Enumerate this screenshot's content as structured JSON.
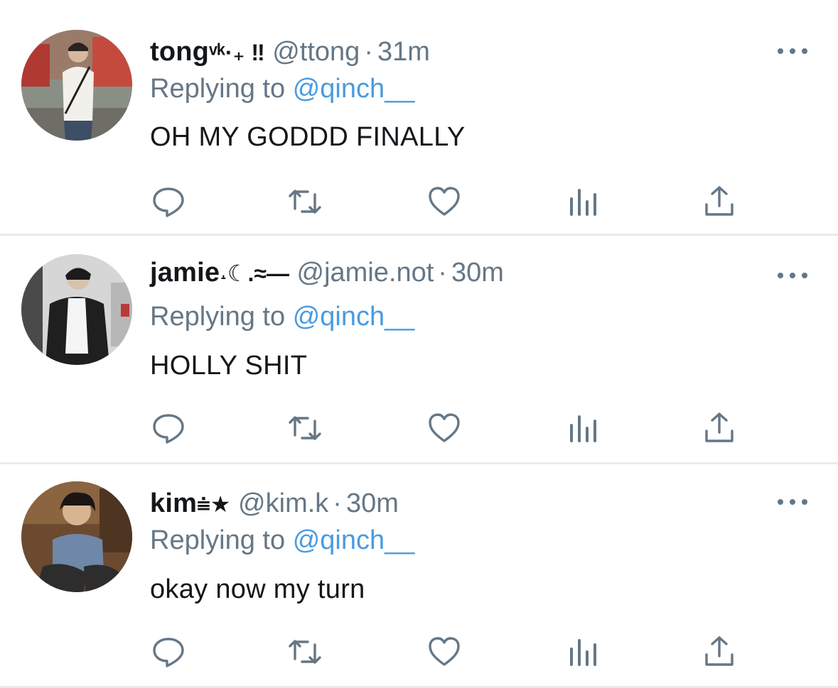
{
  "tweets": [
    {
      "display_name": "tong",
      "name_decoration": "ᵛᵏ·₊ ‼",
      "handle": "@ttong",
      "time": "31m",
      "replying_prefix": "Replying to",
      "replying_to": "@qinch__",
      "text": "OH MY GODDD FINALLY"
    },
    {
      "display_name": "jamie",
      "name_decoration": "˔☾.≈—",
      "handle": "@jamie.not",
      "time": "30m",
      "replying_prefix": "Replying to",
      "replying_to": "@qinch__",
      "text": "HOLLY SHIT"
    },
    {
      "display_name": "kim",
      "name_decoration": "⩧★",
      "handle": "@kim.k",
      "time": "30m",
      "replying_prefix": "Replying to",
      "replying_to": "@qinch__",
      "text": "okay now my turn"
    }
  ],
  "separator": "·",
  "icons": {
    "reply": "reply-icon",
    "retweet": "retweet-icon",
    "like": "heart-icon",
    "analytics": "analytics-icon",
    "share": "share-icon",
    "more": "more-dots-icon"
  },
  "colors": {
    "text": "#14171a",
    "secondary": "#657786",
    "link": "#4a9be0",
    "divider": "#e6ecf0"
  }
}
